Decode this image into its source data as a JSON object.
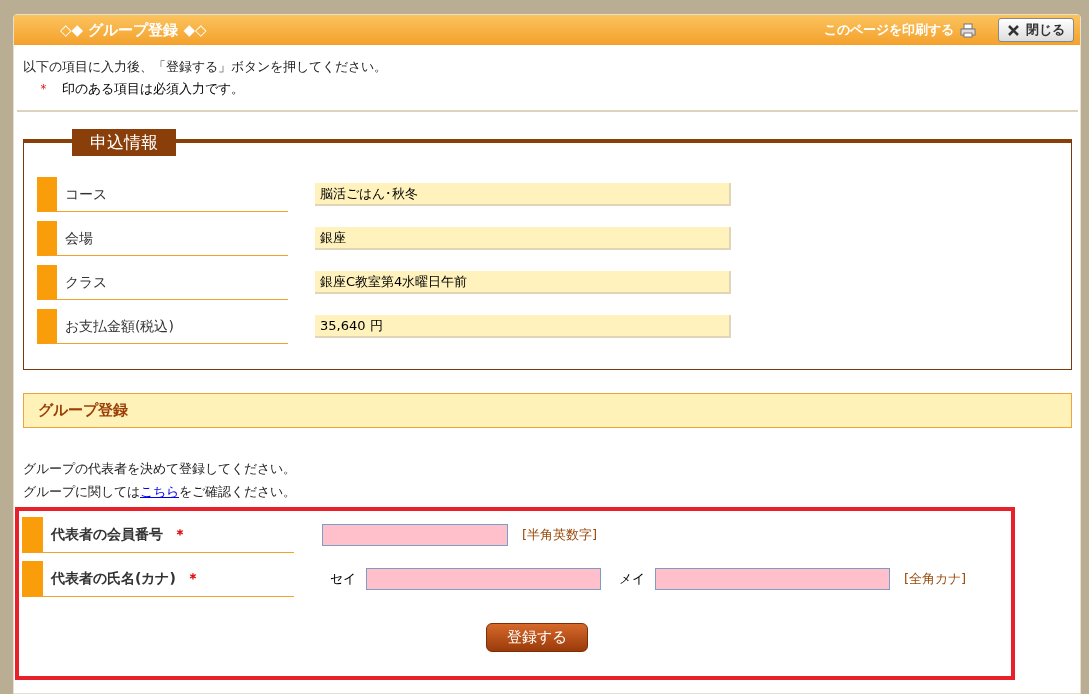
{
  "dialog": {
    "title": "◇◆ グループ登録 ◆◇",
    "print_link": "このページを印刷する",
    "close_button": "閉じる"
  },
  "intro": {
    "line_1": "以下の項目に入力後、「登録する」ボタンを押してください。",
    "required_mark": "＊",
    "line_2": "印のある項目は必須入力です。"
  },
  "application_info": {
    "legend": "申込情報",
    "rows": [
      {
        "label": "コース",
        "value": "脳活ごはん･秋冬"
      },
      {
        "label": "会場",
        "value": "銀座"
      },
      {
        "label": "クラス",
        "value": "銀座C教室第4水曜日午前"
      },
      {
        "label": "お支払金額(税込)",
        "value": "35,640 円"
      }
    ]
  },
  "group_registration": {
    "heading": "グループ登録",
    "text_1": "グループの代表者を決めて登録してください。",
    "text_2_before": "グループに関しては",
    "text_2_link": "こちら",
    "text_2_after": "をご確認ください。",
    "fields": [
      {
        "kind": "single",
        "label": "代表者の会員番号",
        "required_mark": "＊",
        "hint": "[半角英数字]"
      },
      {
        "kind": "kana",
        "label": "代表者の氏名(カナ)",
        "required_mark": "＊",
        "sei_label": "セイ",
        "mei_label": "メイ",
        "hint": "[全角カナ]"
      }
    ],
    "submit_button": "登録する"
  }
}
